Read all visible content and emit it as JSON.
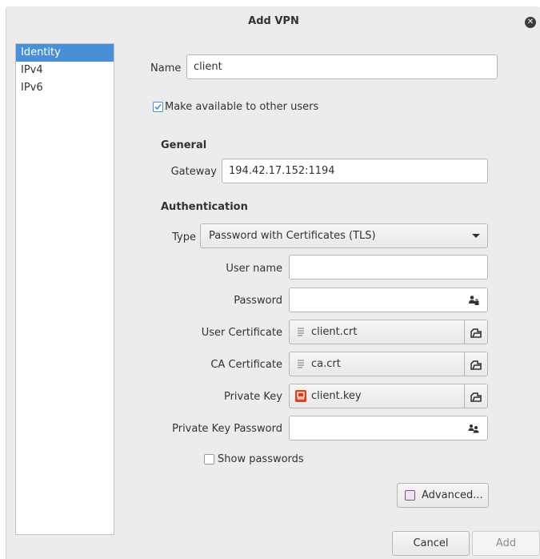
{
  "dialog": {
    "title": "Add VPN",
    "close_icon": "close-icon"
  },
  "sidebar": {
    "items": [
      {
        "label": "Identity",
        "active": true
      },
      {
        "label": "IPv4",
        "active": false
      },
      {
        "label": "IPv6",
        "active": false
      }
    ]
  },
  "identity": {
    "name_label": "Name",
    "name_value": "client",
    "available_label": "Make available to other users",
    "available_checked": true
  },
  "general": {
    "header": "General",
    "gateway_label": "Gateway",
    "gateway_value": "194.42.17.152:1194"
  },
  "authentication": {
    "header": "Authentication",
    "type_label": "Type",
    "type_value": "Password with Certificates (TLS)",
    "username_label": "User name",
    "username_value": "",
    "password_label": "Password",
    "password_value": "",
    "user_cert_label": "User Certificate",
    "user_cert_value": "client.crt",
    "ca_cert_label": "CA Certificate",
    "ca_cert_value": "ca.crt",
    "private_key_label": "Private Key",
    "private_key_value": "client.key",
    "private_key_password_label": "Private Key Password",
    "private_key_password_value": "",
    "show_passwords_label": "Show passwords",
    "show_passwords_checked": false,
    "advanced_label": "Advanced..."
  },
  "footer": {
    "cancel_label": "Cancel",
    "add_label": "Add"
  },
  "colors": {
    "accent": "#4a90d9",
    "key_file": "#e0401c",
    "background": "#ececec"
  }
}
